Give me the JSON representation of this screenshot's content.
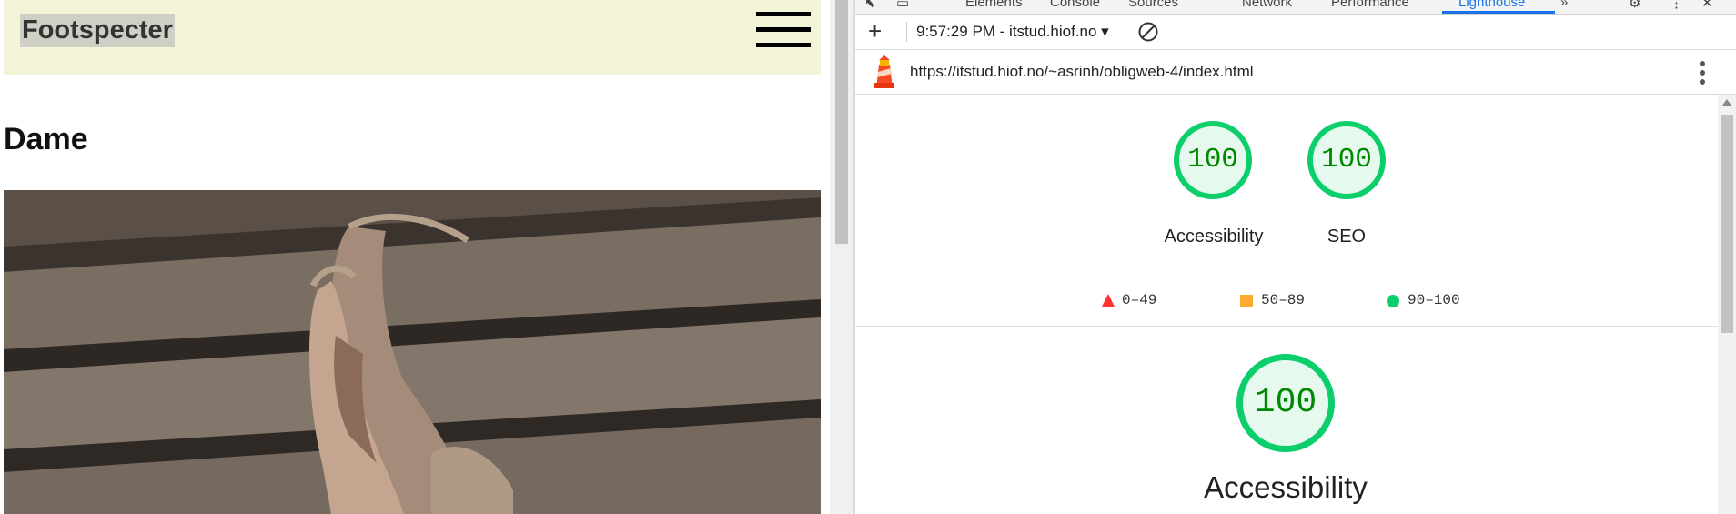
{
  "site": {
    "brand": "Footspecter",
    "section_title": "Dame"
  },
  "devtools": {
    "tabs": [
      "Elements",
      "Console",
      "Sources",
      "Network",
      "Performance",
      "Lighthouse",
      "»"
    ],
    "active_tab": "Lighthouse",
    "report_select": "9:57:29 PM - itstud.hiof.no ▾",
    "url": "https://itstud.hiof.no/~asrinh/obligweb-4/index.html",
    "scores": [
      {
        "label": "Accessibility",
        "value": "100"
      },
      {
        "label": "SEO",
        "value": "100"
      }
    ],
    "legend": [
      {
        "range": "0–49",
        "color": "#ff3333",
        "shape": "triangle"
      },
      {
        "range": "50–89",
        "color": "#ffaa33",
        "shape": "square"
      },
      {
        "range": "90–100",
        "color": "#0cce6b",
        "shape": "circle"
      }
    ],
    "category": {
      "label": "Accessibility",
      "value": "100"
    }
  },
  "colors": {
    "pass_green": "#0cce6b",
    "score_text": "#008800",
    "header_bg": "#f4f4d8",
    "accent_blue": "#1a73e8"
  }
}
